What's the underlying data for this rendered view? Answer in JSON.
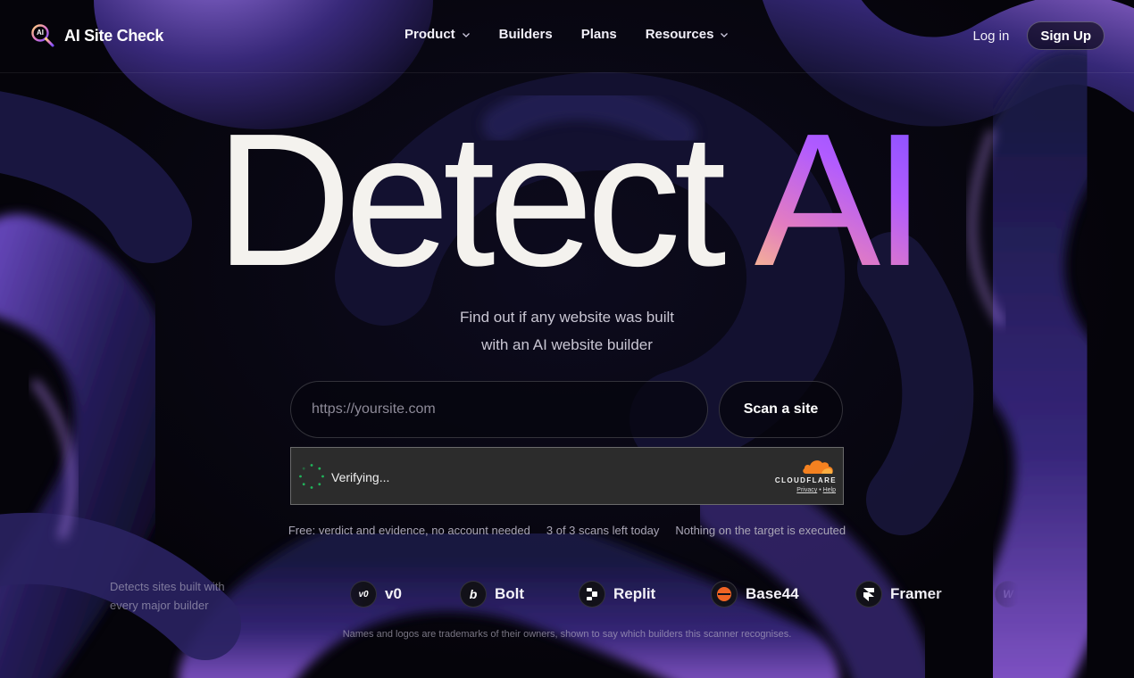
{
  "brand": {
    "icon_text": "AI",
    "name": "AI Site Check"
  },
  "nav": {
    "links": [
      {
        "label": "Product",
        "has_dropdown": true
      },
      {
        "label": "Builders",
        "has_dropdown": false
      },
      {
        "label": "Plans",
        "has_dropdown": false
      },
      {
        "label": "Resources",
        "has_dropdown": true
      }
    ],
    "login_label": "Log in",
    "signup_label": "Sign Up"
  },
  "hero": {
    "title_plain": "Detect",
    "title_gradient": "AI",
    "subtitle_line1": "Find out if any website was built",
    "subtitle_line2": "with an AI website builder"
  },
  "scan": {
    "input_value": "",
    "input_placeholder": "https://yoursite.com",
    "button_label": "Scan a site"
  },
  "turnstile": {
    "status_text": "Verifying...",
    "brand_word": "CLOUDFLARE",
    "privacy_label": "Privacy",
    "separator": "•",
    "help_label": "Help"
  },
  "info_items": [
    "Free: verdict and evidence, no account needed",
    "3 of 3 scans left today",
    "Nothing on the target is executed"
  ],
  "builders_section": {
    "caption_line1": "Detects sites built with",
    "caption_line2": "every major builder",
    "builders": [
      {
        "name": "",
        "icon": "partial-logo-icon",
        "icon_text": ""
      },
      {
        "name": "v0",
        "icon": "v0-logo-icon",
        "icon_text": "v0"
      },
      {
        "name": "Bolt",
        "icon": "bolt-logo-icon",
        "icon_text": "b"
      },
      {
        "name": "Replit",
        "icon": "replit-logo-icon",
        "icon_text": ""
      },
      {
        "name": "Base44",
        "icon": "base44-logo-icon",
        "icon_text": ""
      },
      {
        "name": "Framer",
        "icon": "framer-logo-icon",
        "icon_text": ""
      },
      {
        "name": "",
        "icon": "webflow-logo-icon",
        "icon_text": "W"
      }
    ],
    "disclaimer": "Names and logos are trademarks of their owners, shown to say which builders this scanner recognises."
  },
  "colors": {
    "accent_violet": "#7b4dff",
    "accent_purple": "#b15bff",
    "accent_pink": "#e27cc2",
    "accent_gold": "#ffd37a",
    "cloudflare_orange": "#f48120",
    "spinner_green": "#21b55b"
  }
}
